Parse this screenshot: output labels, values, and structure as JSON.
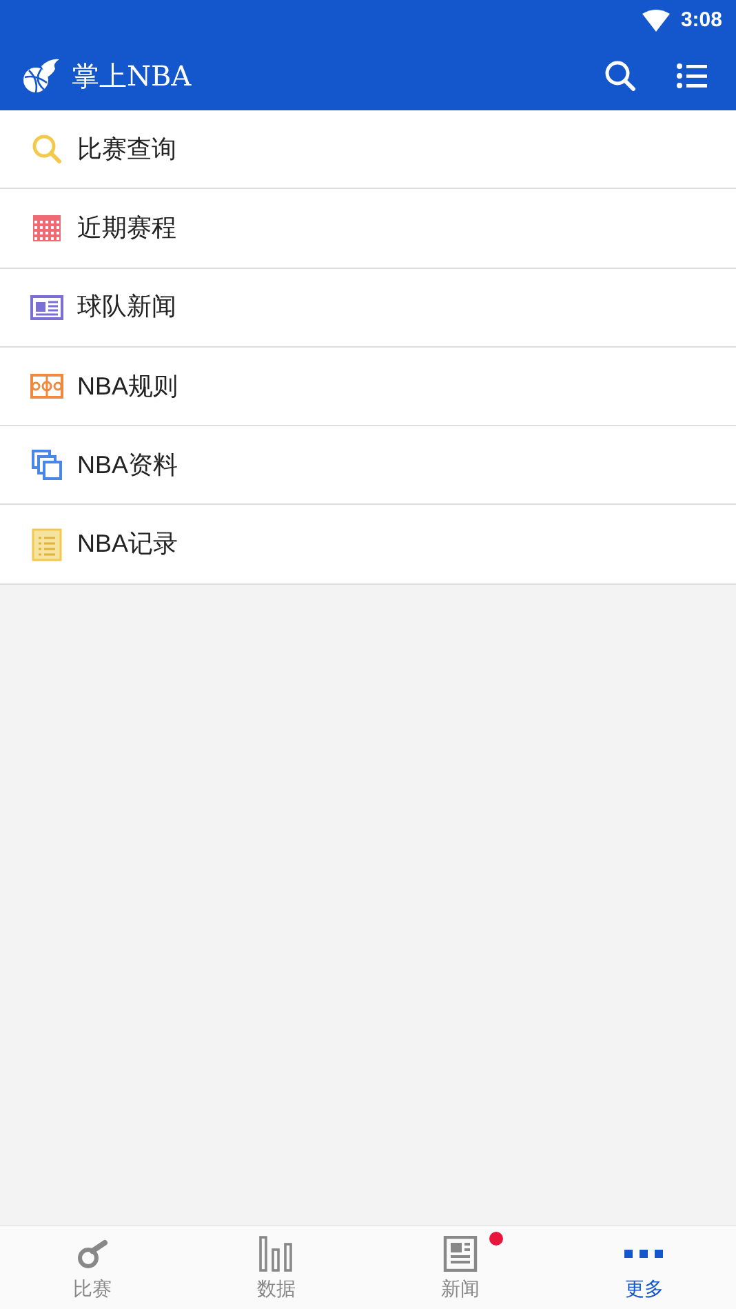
{
  "status_bar": {
    "time": "3:08"
  },
  "app_bar": {
    "title": "掌上NBA"
  },
  "menu": [
    {
      "kind": "search",
      "label": "比赛查询"
    },
    {
      "kind": "calendar",
      "label": "近期赛程"
    },
    {
      "kind": "news",
      "label": "球队新闻"
    },
    {
      "kind": "court",
      "label": "NBA规则"
    },
    {
      "kind": "copies",
      "label": "NBA资料"
    },
    {
      "kind": "list",
      "label": "NBA记录"
    }
  ],
  "bottom_nav": [
    {
      "kind": "whistle",
      "label": "比赛",
      "selected": false,
      "badge": false
    },
    {
      "kind": "bars",
      "label": "数据",
      "selected": false,
      "badge": false
    },
    {
      "kind": "news",
      "label": "新闻",
      "selected": false,
      "badge": true
    },
    {
      "kind": "more",
      "label": "更多",
      "selected": true,
      "badge": false
    }
  ]
}
